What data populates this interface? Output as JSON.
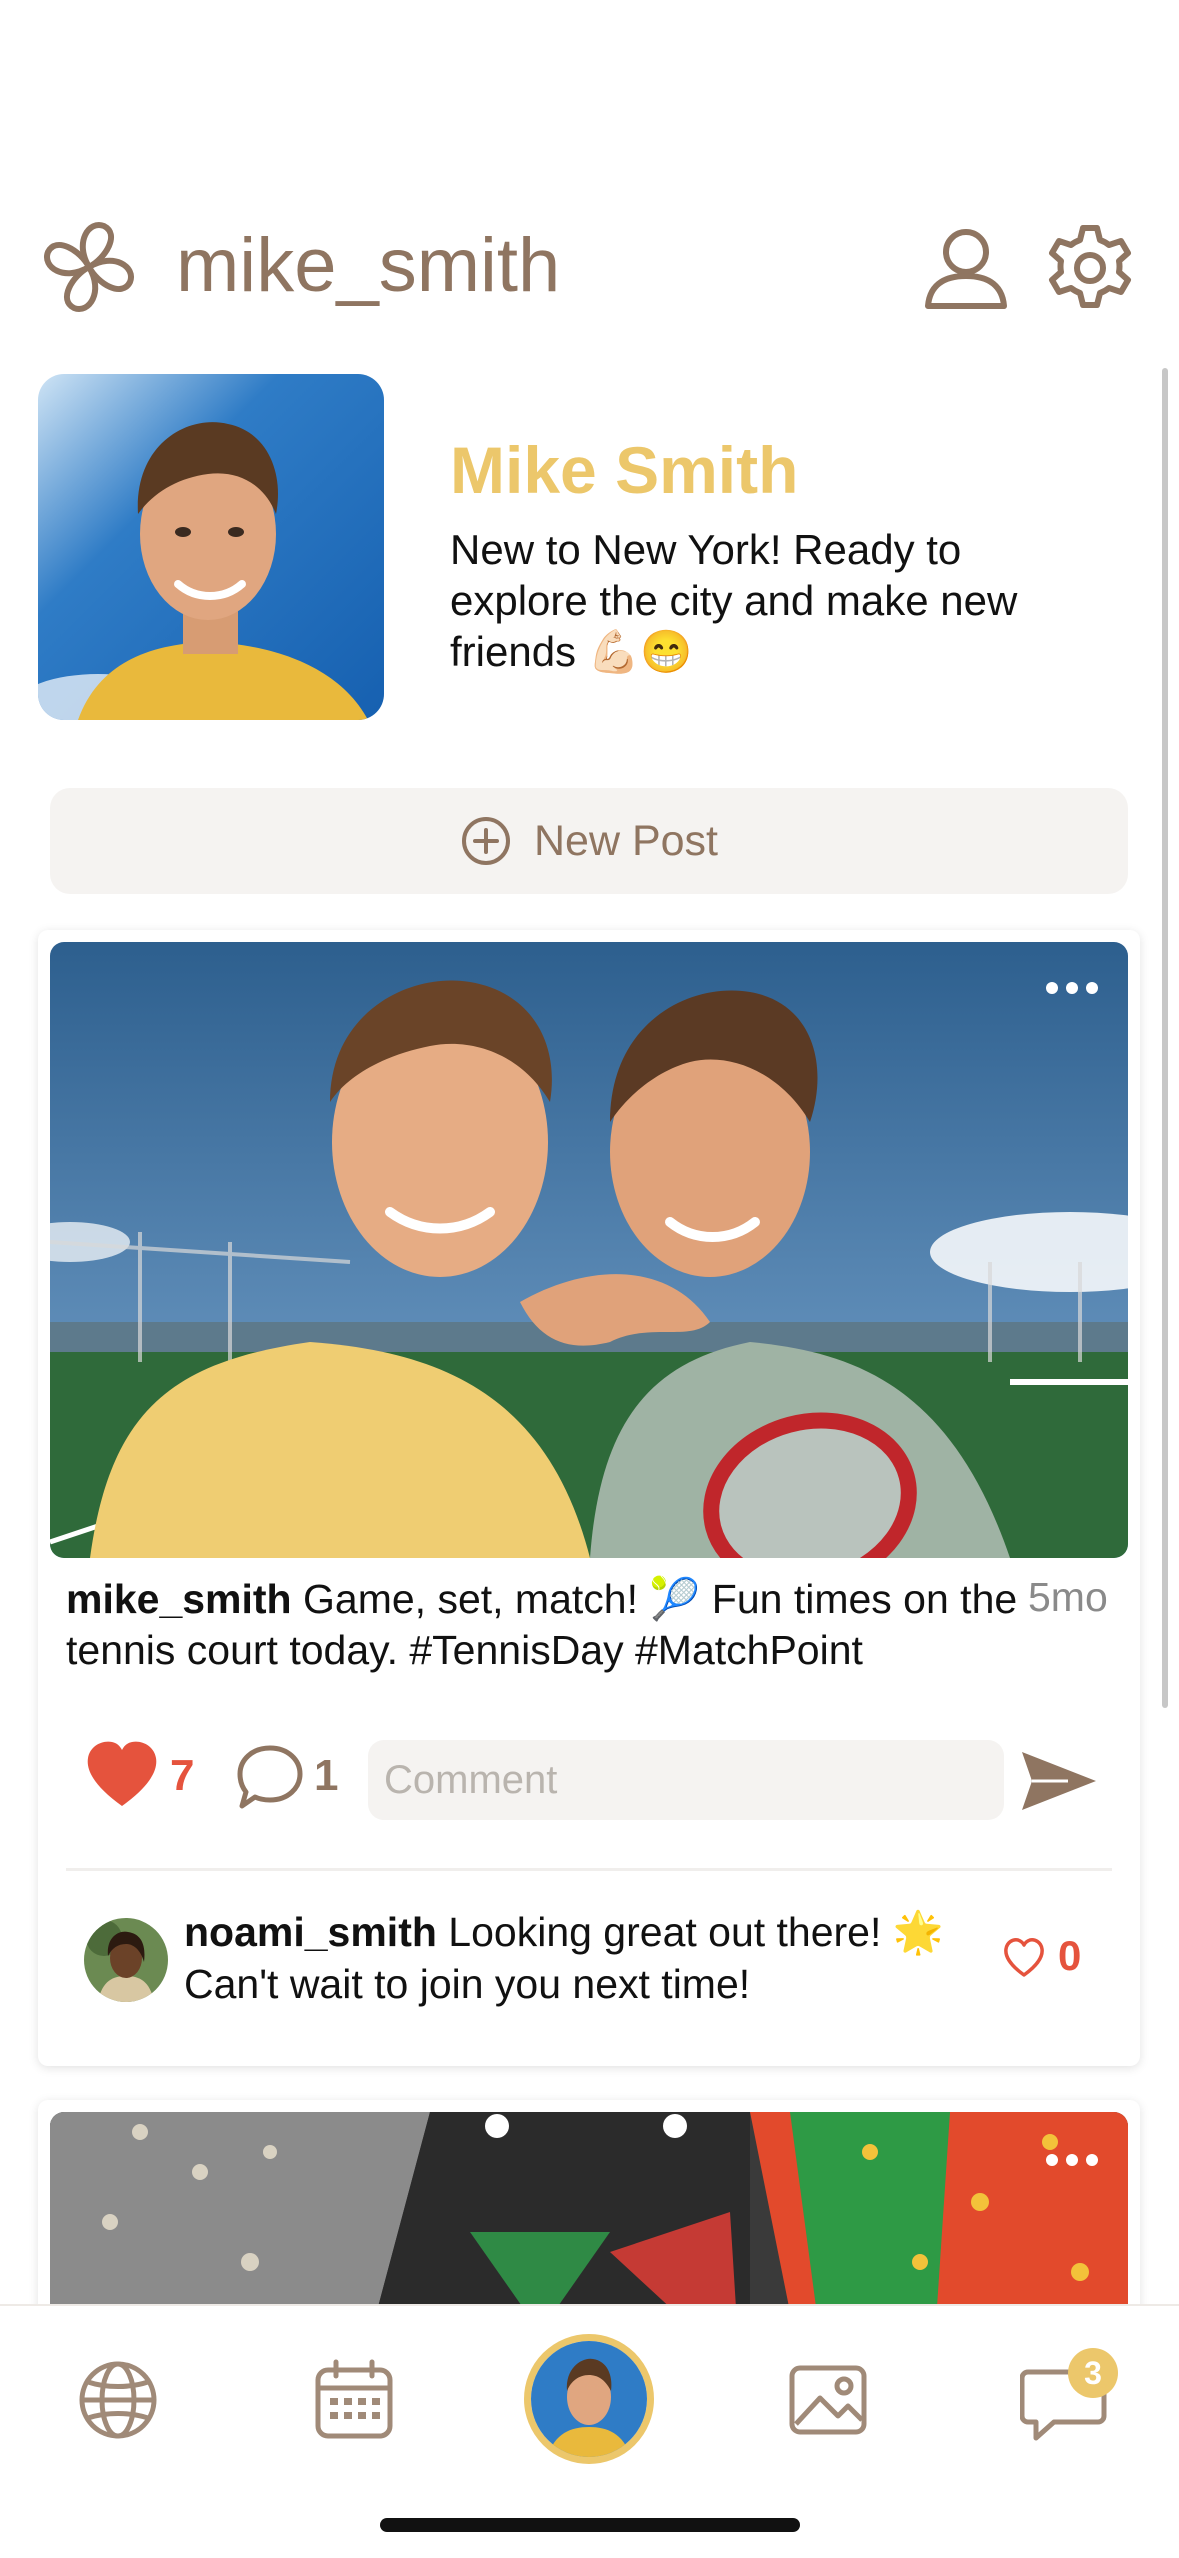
{
  "header": {
    "logo_icon": "clover-logo-icon",
    "username": "mike_smith",
    "profile_icon": "person-icon",
    "settings_icon": "gear-icon"
  },
  "profile": {
    "name": "Mike Smith",
    "bio": "New to New York! Ready to explore the city and make new friends 💪🏻😁"
  },
  "new_post": {
    "label": "New Post",
    "icon": "plus-circle-icon"
  },
  "posts": [
    {
      "author": "mike_smith",
      "caption": "Game, set, match! 🎾 Fun times on the tennis court today. #TennisDay #MatchPoint",
      "time": "5mo",
      "likes": "7",
      "comments_count": "1",
      "comment_placeholder": "Comment",
      "comments": [
        {
          "author": "noami_smith",
          "text": "Looking great out there! 🌟 Can't wait to join you next time!",
          "likes": "0"
        }
      ]
    }
  ],
  "tabbar": {
    "tabs": [
      "globe-icon",
      "calendar-icon",
      "profile-avatar",
      "photo-icon",
      "chat-icon"
    ],
    "chat_badge": "3"
  },
  "colors": {
    "brand_brown": "#8f7561",
    "accent_gold": "#ecc76b",
    "like_red": "#e5533d",
    "input_bg": "#f5f3f1"
  }
}
